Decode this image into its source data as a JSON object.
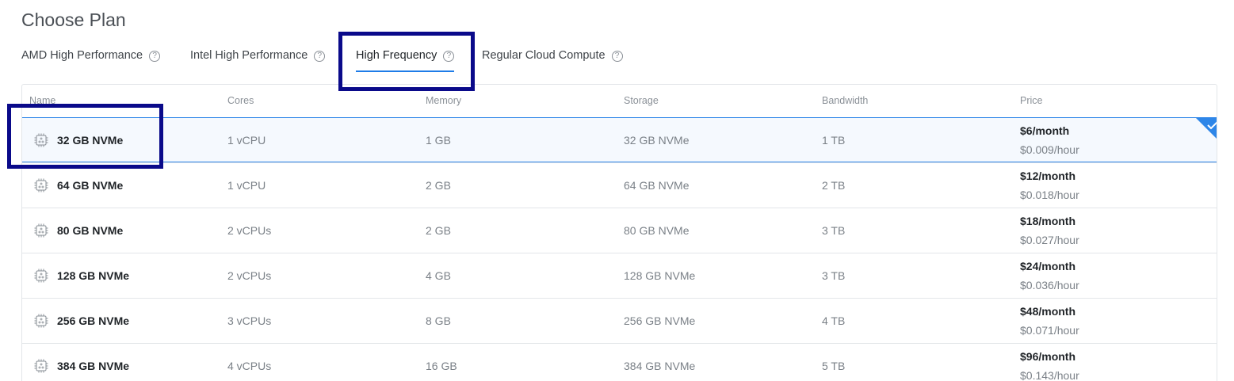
{
  "title": "Choose Plan",
  "tabs": [
    {
      "label": "AMD High Performance",
      "help": "?"
    },
    {
      "label": "Intel High Performance",
      "help": "?"
    },
    {
      "label": "High Frequency",
      "help": "?"
    },
    {
      "label": "Regular Cloud Compute",
      "help": "?"
    }
  ],
  "active_tab": "High Frequency",
  "columns": [
    "Name",
    "Cores",
    "Memory",
    "Storage",
    "Bandwidth",
    "Price"
  ],
  "plans": [
    {
      "name": "32 GB NVMe",
      "cores": "1 vCPU",
      "memory": "1 GB",
      "storage": "32 GB NVMe",
      "bandwidth": "1 TB",
      "price_month": "$6/month",
      "price_hour": "$0.009/hour",
      "selected": true
    },
    {
      "name": "64 GB NVMe",
      "cores": "1 vCPU",
      "memory": "2 GB",
      "storage": "64 GB NVMe",
      "bandwidth": "2 TB",
      "price_month": "$12/month",
      "price_hour": "$0.018/hour",
      "selected": false
    },
    {
      "name": "80 GB NVMe",
      "cores": "2 vCPUs",
      "memory": "2 GB",
      "storage": "80 GB NVMe",
      "bandwidth": "3 TB",
      "price_month": "$18/month",
      "price_hour": "$0.027/hour",
      "selected": false
    },
    {
      "name": "128 GB NVMe",
      "cores": "2 vCPUs",
      "memory": "4 GB",
      "storage": "128 GB NVMe",
      "bandwidth": "3 TB",
      "price_month": "$24/month",
      "price_hour": "$0.036/hour",
      "selected": false
    },
    {
      "name": "256 GB NVMe",
      "cores": "3 vCPUs",
      "memory": "8 GB",
      "storage": "256 GB NVMe",
      "bandwidth": "4 TB",
      "price_month": "$48/month",
      "price_hour": "$0.071/hour",
      "selected": false
    },
    {
      "name": "384 GB NVMe",
      "cores": "4 vCPUs",
      "memory": "16 GB",
      "storage": "384 GB NVMe",
      "bandwidth": "5 TB",
      "price_month": "$96/month",
      "price_hour": "$0.143/hour",
      "selected": false
    }
  ],
  "icons": {
    "plan": "cpu-chip-icon",
    "help": "help-circle-icon",
    "selected": "checkmark-icon"
  },
  "colors": {
    "accent": "#1e7ce8",
    "selected_border": "#2e86e8",
    "annotation_box": "#0a0a8a"
  }
}
